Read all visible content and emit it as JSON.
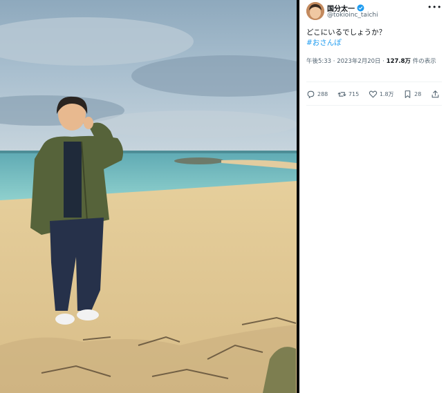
{
  "tweet": {
    "display_name": "国分太一",
    "handle": "@tokioinc_taichi",
    "text": "どこにいるでしょうか？",
    "hashtag": "#おさんぽ",
    "time": "午後5:33",
    "separator": " · ",
    "date": "2023年2月20日",
    "views_count": "127.8万",
    "views_label": " 件の表示"
  },
  "actions": {
    "reply_count": "288",
    "retweet_count": "715",
    "like_count": "1.8万",
    "bookmark_count": "28"
  },
  "icons": [
    "verified-icon",
    "more-icon",
    "reply-icon",
    "retweet-icon",
    "like-icon",
    "bookmark-icon",
    "share-icon"
  ],
  "colors": {
    "accent": "#1d9bf0",
    "text": "#0f1419",
    "secondary_text": "#536471"
  }
}
